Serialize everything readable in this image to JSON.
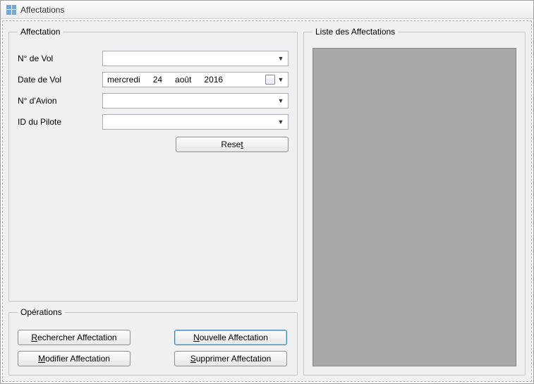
{
  "window": {
    "title": "Affectations"
  },
  "group_affectation": {
    "legend": "Affectation",
    "fields": {
      "vol_label": "N° de Vol",
      "vol_value": "",
      "date_label": "Date de Vol",
      "date_weekday": "mercredi",
      "date_day": "24",
      "date_month": "août",
      "date_year": "2016",
      "avion_label": "N° d'Avion",
      "avion_value": "",
      "pilote_label": "ID du Pilote",
      "pilote_value": ""
    },
    "reset_prefix": "Rese",
    "reset_mnemonic": "t"
  },
  "group_operations": {
    "legend": "Opérations",
    "buttons": {
      "rechercher": {
        "mnemonic": "R",
        "rest": "echercher Affectation"
      },
      "nouvelle": {
        "mnemonic": "N",
        "rest": "ouvelle Affectation"
      },
      "modifier": {
        "mnemonic": "M",
        "rest": "odifier Affectation"
      },
      "supprimer": {
        "mnemonic": "S",
        "rest": "upprimer Affectation"
      }
    }
  },
  "group_liste": {
    "legend": "Liste des Affectations"
  }
}
